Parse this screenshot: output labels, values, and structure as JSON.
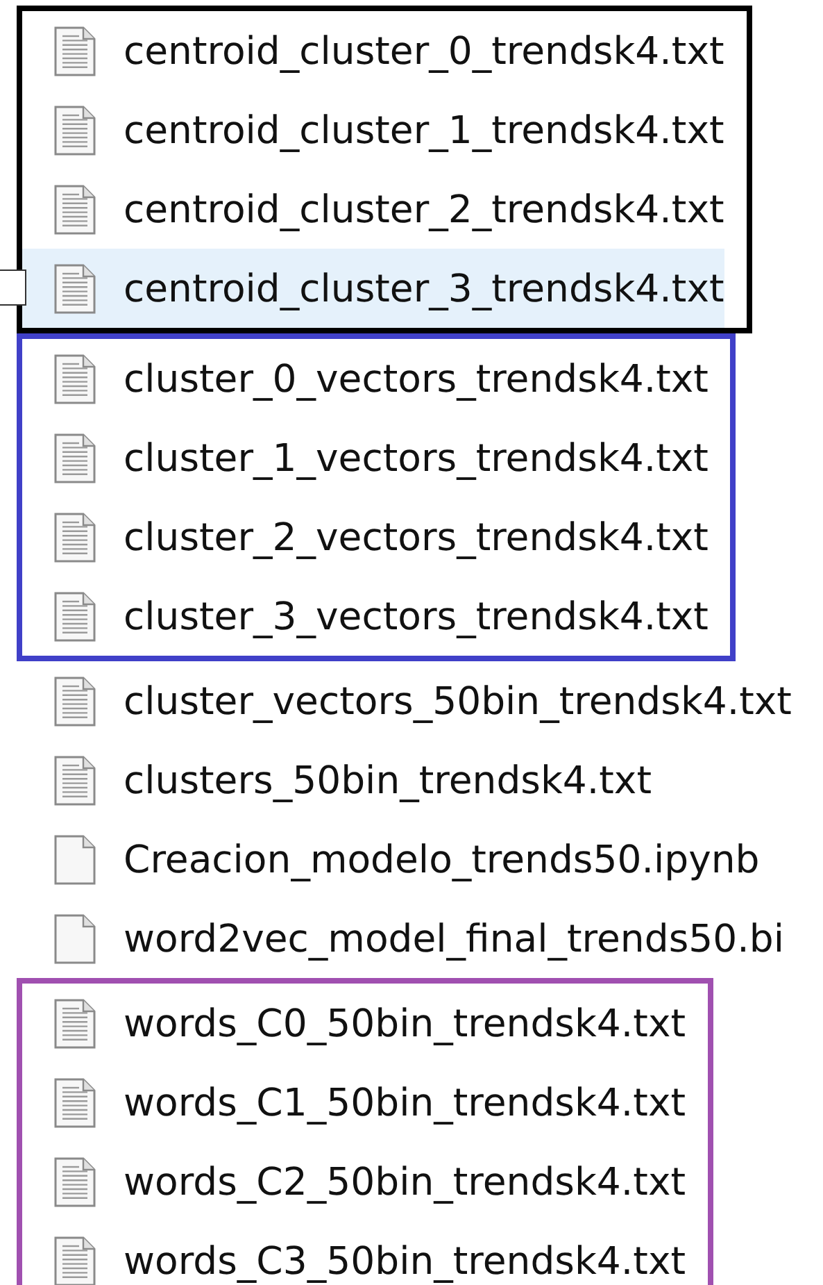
{
  "groups": [
    {
      "kind": "framed",
      "color": "#000000",
      "files": [
        {
          "name": "centroid_cluster_0_trendsk4.txt",
          "kind": "text",
          "selected": false
        },
        {
          "name": "centroid_cluster_1_trendsk4.txt",
          "kind": "text",
          "selected": false
        },
        {
          "name": "centroid_cluster_2_trendsk4.txt",
          "kind": "text",
          "selected": false
        },
        {
          "name": "centroid_cluster_3_trendsk4.txt",
          "kind": "text",
          "selected": true
        }
      ]
    },
    {
      "kind": "framed",
      "color": "#4040c8",
      "files": [
        {
          "name": "cluster_0_vectors_trendsk4.txt",
          "kind": "text",
          "selected": false
        },
        {
          "name": "cluster_1_vectors_trendsk4.txt",
          "kind": "text",
          "selected": false
        },
        {
          "name": "cluster_2_vectors_trendsk4.txt",
          "kind": "text",
          "selected": false
        },
        {
          "name": "cluster_3_vectors_trendsk4.txt",
          "kind": "text",
          "selected": false
        }
      ]
    },
    {
      "kind": "plain",
      "files": [
        {
          "name": "cluster_vectors_50bin_trendsk4.txt",
          "kind": "text",
          "selected": false
        },
        {
          "name": "clusters_50bin_trendsk4.txt",
          "kind": "text",
          "selected": false
        },
        {
          "name": "Creacion_modelo_trends50.ipynb",
          "kind": "blank",
          "selected": false
        },
        {
          "name": "word2vec_model_final_trends50.bi",
          "kind": "blank",
          "selected": false
        }
      ]
    },
    {
      "kind": "framed",
      "color": "#a050b0",
      "files": [
        {
          "name": "words_C0_50bin_trendsk4.txt",
          "kind": "text",
          "selected": false
        },
        {
          "name": "words_C1_50bin_trendsk4.txt",
          "kind": "text",
          "selected": false
        },
        {
          "name": "words_C2_50bin_trendsk4.txt",
          "kind": "text",
          "selected": false
        },
        {
          "name": "words_C3_50bin_trendsk4.txt",
          "kind": "text",
          "selected": false
        }
      ]
    }
  ]
}
